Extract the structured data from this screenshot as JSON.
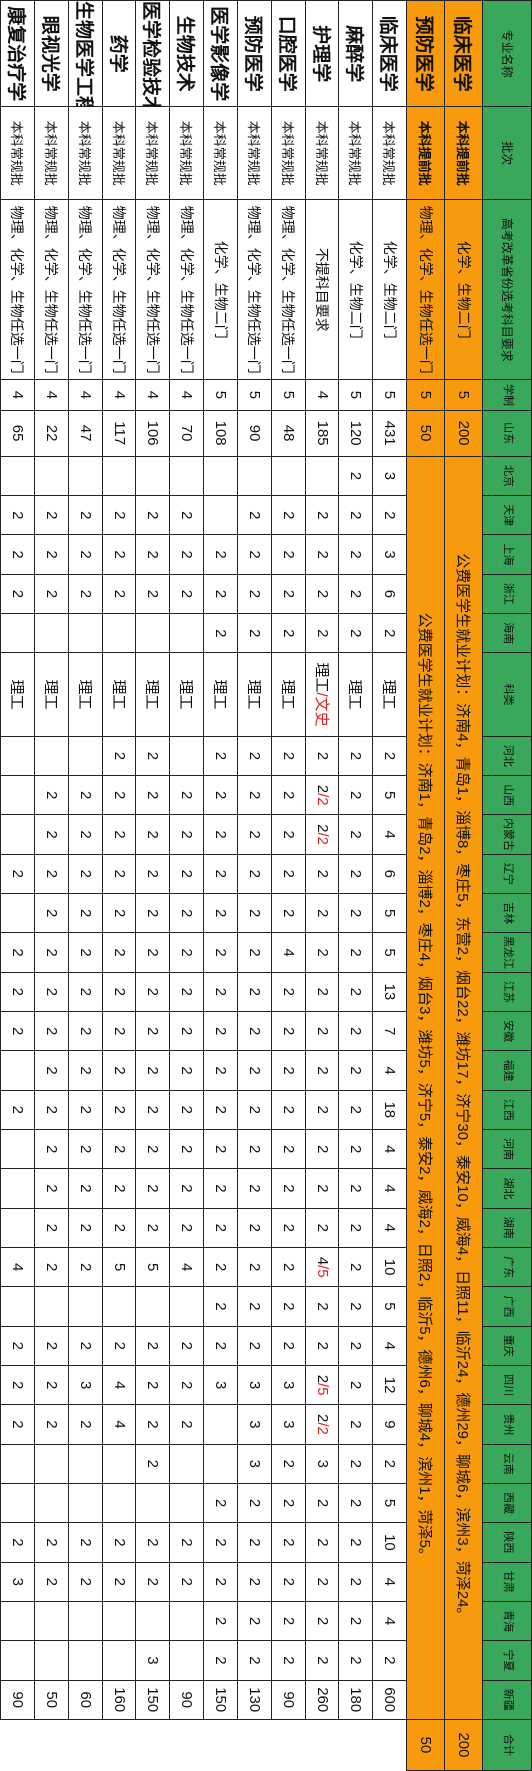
{
  "header": {
    "major": "专业名称",
    "batch": "批次",
    "subject": "高考改革省份选考科目要求",
    "duration": "学制",
    "provinces": [
      "山东",
      "北京",
      "天津",
      "上海",
      "浙江",
      "海南",
      "科类",
      "河北",
      "山西",
      "内蒙古",
      "辽宁",
      "吉林",
      "黑龙江",
      "江苏",
      "安徽",
      "福建",
      "江西",
      "河南",
      "湖北",
      "湖南",
      "广东",
      "广西",
      "重庆",
      "四川",
      "贵州",
      "云南",
      "西藏",
      "陕西",
      "甘肃",
      "青海",
      "宁夏",
      "新疆"
    ],
    "total": "合计"
  },
  "orange_rows": [
    {
      "major": "临床医学",
      "batch": "本科提前批",
      "subject": "化学、生物二门",
      "duration": "5",
      "shandong": "200",
      "note": "公费医学生就业计划：济南4，青岛1，淄博8，枣庄5，东营2，烟台22，潍坊17，济宁30，泰安10，威海4，日照11，临沂24，德州29，聊城6，滨州3，菏泽24。",
      "total": "200"
    },
    {
      "major": "预防医学",
      "batch": "本科提前批",
      "subject": "物理、化学、生物任选一门",
      "duration": "5",
      "shandong": "50",
      "note": "公费医学生就业计划：济南1，青岛2，淄博2，枣庄4，烟台3，潍坊5，济宁5，泰安2，威海2，日照2，临沂5，德州6，聊城4，滨州1，菏泽5。",
      "total": "50"
    }
  ],
  "rows": [
    {
      "major": "临床医学",
      "batch": "本科常规批",
      "subject": "化学、生物二门",
      "cells": [
        "5",
        "431",
        "3",
        "2",
        "3",
        "6",
        "2",
        "理工",
        "2",
        "5",
        "4",
        "6",
        "5",
        "5",
        "13",
        "7",
        "4",
        "18",
        "4",
        "4",
        "4",
        "10",
        "5",
        "4",
        "12",
        "9",
        "2",
        "5",
        "10",
        "4",
        "4",
        "2",
        "600"
      ]
    },
    {
      "major": "麻醉学",
      "batch": "本科常规批",
      "subject": "化学、生物二门",
      "cells": [
        "5",
        "120",
        "2",
        "2",
        "2",
        "2",
        "2",
        "理工",
        "2",
        "2",
        "2",
        "2",
        "2",
        "2",
        "2",
        "2",
        "2",
        "2",
        "2",
        "2",
        "2",
        "2",
        "2",
        "2",
        "2",
        "2",
        "2",
        "2",
        "2",
        "2",
        "2",
        "2",
        "180"
      ]
    },
    {
      "major": "护理学",
      "batch": "本科常规批",
      "subject": "不提科目要求",
      "cells": [
        "4",
        "185",
        "",
        "2",
        "2",
        "2",
        "2",
        "理工/文史",
        "2",
        "2/2",
        "2/2",
        "2",
        "2",
        "2",
        "2",
        "2",
        "2",
        "2",
        "2",
        "2",
        "2",
        "4/5",
        "2",
        "2",
        "2/5",
        "2/2",
        "3",
        "2",
        "2",
        "2",
        "2",
        "2",
        "260"
      ]
    },
    {
      "major": "口腔医学",
      "batch": "本科常规批",
      "subject": "物理、化学、生物任选一门",
      "cells": [
        "5",
        "48",
        "",
        "2",
        "2",
        "2",
        "2",
        "理工",
        "2",
        "2",
        "2",
        "2",
        "2",
        "4",
        "2",
        "2",
        "2",
        "2",
        "2",
        "2",
        "2",
        "2",
        "2",
        "2",
        "3",
        "3",
        "2",
        "2",
        "2",
        "2",
        "2",
        "2",
        "90"
      ]
    },
    {
      "major": "预防医学",
      "batch": "本科常规批",
      "subject": "物理、化学、生物任选一门",
      "cells": [
        "5",
        "90",
        "",
        "2",
        "2",
        "2",
        "2",
        "理工",
        "2",
        "2",
        "2",
        "2",
        "2",
        "2",
        "2",
        "2",
        "2",
        "2",
        "2",
        "2",
        "2",
        "2",
        "2",
        "2",
        "3",
        "3",
        "3",
        "2",
        "2",
        "2",
        "2",
        "2",
        "130"
      ]
    },
    {
      "major": "医学影像学",
      "batch": "本科常规批",
      "subject": "化学、生物二门",
      "cells": [
        "5",
        "108",
        "",
        "",
        "2",
        "2",
        "2",
        "理工",
        "2",
        "2",
        "2",
        "2",
        "2",
        "2",
        "2",
        "2",
        "2",
        "2",
        "2",
        "2",
        "2",
        "2",
        "2",
        "2",
        "3",
        "",
        "",
        "2",
        "2",
        "2",
        "2",
        "2",
        "150"
      ]
    },
    {
      "major": "生物技术",
      "batch": "本科常规批",
      "subject": "物理、化学、生物任选一门",
      "cells": [
        "4",
        "70",
        "",
        "2",
        "2",
        "2",
        "",
        "理工",
        "",
        "2",
        "2",
        "2",
        "2",
        "2",
        "2",
        "2",
        "2",
        "2",
        "2",
        "2",
        "2",
        "4",
        "",
        "2",
        "2",
        "2",
        "",
        "",
        "2",
        "2",
        "",
        "",
        "90"
      ]
    },
    {
      "major": "医学检验技术",
      "batch": "本科常规批",
      "subject": "物理、化学、生物任选一门",
      "cells": [
        "4",
        "106",
        "",
        "2",
        "2",
        "2",
        "",
        "理工",
        "2",
        "2",
        "2",
        "2",
        "2",
        "2",
        "2",
        "2",
        "2",
        "2",
        "2",
        "2",
        "2",
        "5",
        "",
        "2",
        "2",
        "2",
        "2",
        "",
        "2",
        "2",
        "",
        "3",
        "150"
      ]
    },
    {
      "major": "药学",
      "batch": "本科常规批",
      "subject": "物理、化学、生物任选一门",
      "cells": [
        "4",
        "117",
        "",
        "2",
        "2",
        "2",
        "",
        "理工",
        "2",
        "2",
        "2",
        "2",
        "2",
        "2",
        "2",
        "2",
        "2",
        "2",
        "2",
        "2",
        "2",
        "5",
        "",
        "2",
        "4",
        "4",
        "",
        "",
        "2",
        "2",
        "",
        "",
        "160"
      ]
    },
    {
      "major": "生物医学工程",
      "batch": "本科常规批",
      "subject": "物理、化学、生物任选一门",
      "cells": [
        "4",
        "47",
        "",
        "2",
        "2",
        "2",
        "",
        "理工",
        "",
        "2",
        "2",
        "2",
        "2",
        "2",
        "2",
        "2",
        "2",
        "2",
        "2",
        "2",
        "2",
        "2",
        "",
        "2",
        "3",
        "2",
        "",
        "",
        "2",
        "2",
        "",
        "",
        "60"
      ]
    },
    {
      "major": "眼视光学",
      "batch": "本科常规批",
      "subject": "物理、化学、生物任选一门",
      "cells": [
        "4",
        "22",
        "",
        "2",
        "2",
        "2",
        "",
        "理工",
        "",
        "2",
        "2",
        "2",
        "2",
        "2",
        "2",
        "2",
        "2",
        "2",
        "2",
        "2",
        "2",
        "2",
        "",
        "2",
        "2",
        "2",
        "",
        "",
        "2",
        "2",
        "",
        "",
        "50"
      ]
    },
    {
      "major": "康复治疗学",
      "batch": "本科常规批",
      "subject": "物理、化学、生物任选一门",
      "cells": [
        "4",
        "65",
        "",
        "2",
        "2",
        "2",
        "",
        "理工",
        "",
        "",
        "",
        "2",
        "",
        "2",
        "2",
        "2",
        "",
        "2",
        "",
        "",
        "",
        "4",
        "",
        "2",
        "2",
        "2",
        "",
        "",
        "2",
        "3",
        "",
        "",
        "90"
      ]
    }
  ],
  "colors": {
    "header_green": "#3aa85b",
    "highlight_orange": "#f79a0d",
    "emphasis_red": "#e02020"
  }
}
